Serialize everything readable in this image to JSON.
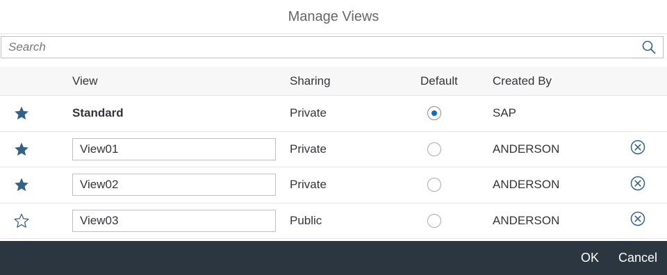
{
  "dialog": {
    "title": "Manage Views"
  },
  "search": {
    "placeholder": "Search",
    "value": ""
  },
  "columns": {
    "view": "View",
    "sharing": "Sharing",
    "default": "Default",
    "created_by": "Created By"
  },
  "rows": [
    {
      "favorite": true,
      "view": "Standard",
      "editable": false,
      "sharing": "Private",
      "default": true,
      "created_by": "SAP",
      "deletable": false
    },
    {
      "favorite": true,
      "view": "View01",
      "editable": true,
      "sharing": "Private",
      "default": false,
      "created_by": "ANDERSON",
      "deletable": true
    },
    {
      "favorite": true,
      "view": "View02",
      "editable": true,
      "sharing": "Private",
      "default": false,
      "created_by": "ANDERSON",
      "deletable": true
    },
    {
      "favorite": false,
      "view": "View03",
      "editable": true,
      "sharing": "Public",
      "default": false,
      "created_by": "ANDERSON",
      "deletable": true
    }
  ],
  "footer": {
    "ok_label": "OK",
    "cancel_label": "Cancel"
  },
  "colors": {
    "accent": "#0a6ed1",
    "star": "#346187",
    "footer_bg": "#2b3641"
  },
  "icons": {
    "favorite": "star-filled-icon",
    "not_favorite": "star-outline-icon",
    "delete": "decline-circle-icon",
    "search": "search-icon"
  }
}
